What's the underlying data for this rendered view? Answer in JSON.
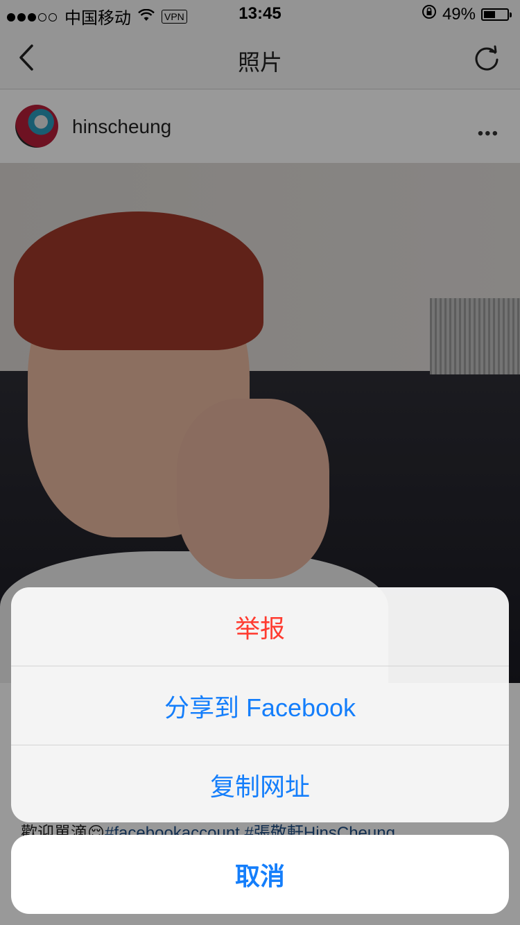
{
  "status_bar": {
    "carrier": "中国移动",
    "vpn": "VPN",
    "time": "13:45",
    "battery": "49%",
    "battery_level": 0.49,
    "signal_bars_filled": 3,
    "signal_bars_total": 5
  },
  "nav": {
    "title": "照片",
    "back_icon": "chevron-left-icon",
    "refresh_icon": "refresh-icon"
  },
  "post": {
    "username": "hinscheung",
    "more": "•••",
    "caption_prefix": "歡迎單滴",
    "caption_emoji": "😌",
    "caption_tags": "#facebookaccount #張敬軒HinsCheung"
  },
  "action_sheet": {
    "report": "举报",
    "share_facebook": "分享到 Facebook",
    "copy_url": "复制网址",
    "cancel": "取消"
  },
  "colors": {
    "ios_blue": "#147efb",
    "ios_red": "#ff3b30"
  }
}
